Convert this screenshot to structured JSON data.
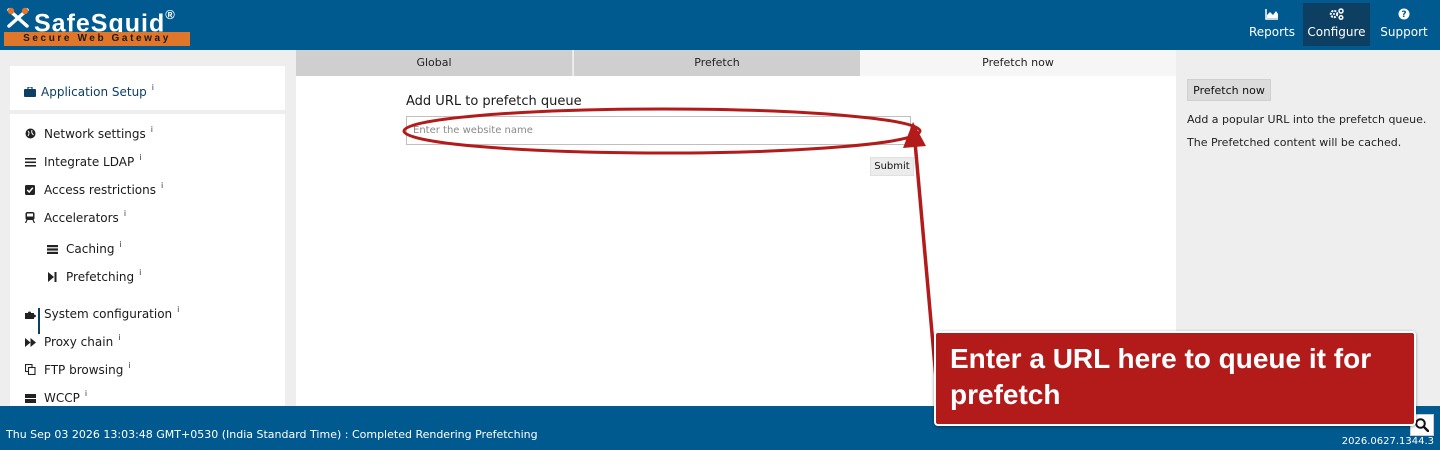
{
  "header": {
    "logo_title": "SafeSquid",
    "logo_registered": "®",
    "logo_tagline": "Secure Web Gateway",
    "nav": [
      {
        "label": "Reports",
        "icon": "area-chart-icon"
      },
      {
        "label": "Configure",
        "icon": "cogs-icon",
        "active": true
      },
      {
        "label": "Support",
        "icon": "question-circle-icon"
      }
    ]
  },
  "sidebar": {
    "section": {
      "label": "Application Setup",
      "icon": "briefcase-icon",
      "info": "i"
    },
    "items": [
      {
        "label": "Network settings",
        "icon": "globe-icon",
        "info": "i"
      },
      {
        "label": "Integrate LDAP",
        "icon": "list-icon",
        "info": "i"
      },
      {
        "label": "Access restrictions",
        "icon": "check-square-icon",
        "info": "i"
      },
      {
        "label": "Accelerators",
        "icon": "train-icon",
        "info": "i"
      },
      {
        "label": "Caching",
        "icon": "database-icon",
        "info": "i"
      },
      {
        "label": "Prefetching",
        "icon": "step-forward-icon",
        "info": "i",
        "active": true
      },
      {
        "label": "System configuration",
        "icon": "puzzle-icon",
        "info": "i"
      },
      {
        "label": "Proxy chain",
        "icon": "fast-forward-icon",
        "info": "i"
      },
      {
        "label": "FTP browsing",
        "icon": "copy-icon",
        "info": "i"
      },
      {
        "label": "WCCP",
        "icon": "server-icon",
        "info": "i"
      }
    ]
  },
  "tabs": [
    {
      "label": "Global"
    },
    {
      "label": "Prefetch"
    },
    {
      "label": "Prefetch now",
      "active": true
    }
  ],
  "main": {
    "form_title": "Add URL to prefetch queue",
    "url_input": {
      "value": "",
      "placeholder": "Enter the website name"
    },
    "submit_label": "Submit"
  },
  "right_panel": {
    "button_label": "Prefetch now",
    "description_line1": "Add a popular URL into the prefetch queue.",
    "description_line2": "The Prefetched content will be cached."
  },
  "footer": {
    "status": "Thu Sep 03 2026 13:03:48 GMT+0530 (India Standard Time) : Completed Rendering Prefetching",
    "version": "2026.0627.1344.3",
    "search_icon": "search-icon"
  },
  "annotation": {
    "callout_text": "Enter a URL here to queue it for prefetch",
    "color": "#b31b1b"
  },
  "colors": {
    "header_bg": "#005a8f",
    "nav_active_bg": "#0d3f63",
    "logo_tag_bg": "#e0762a",
    "page_bg": "#eeeeee"
  }
}
